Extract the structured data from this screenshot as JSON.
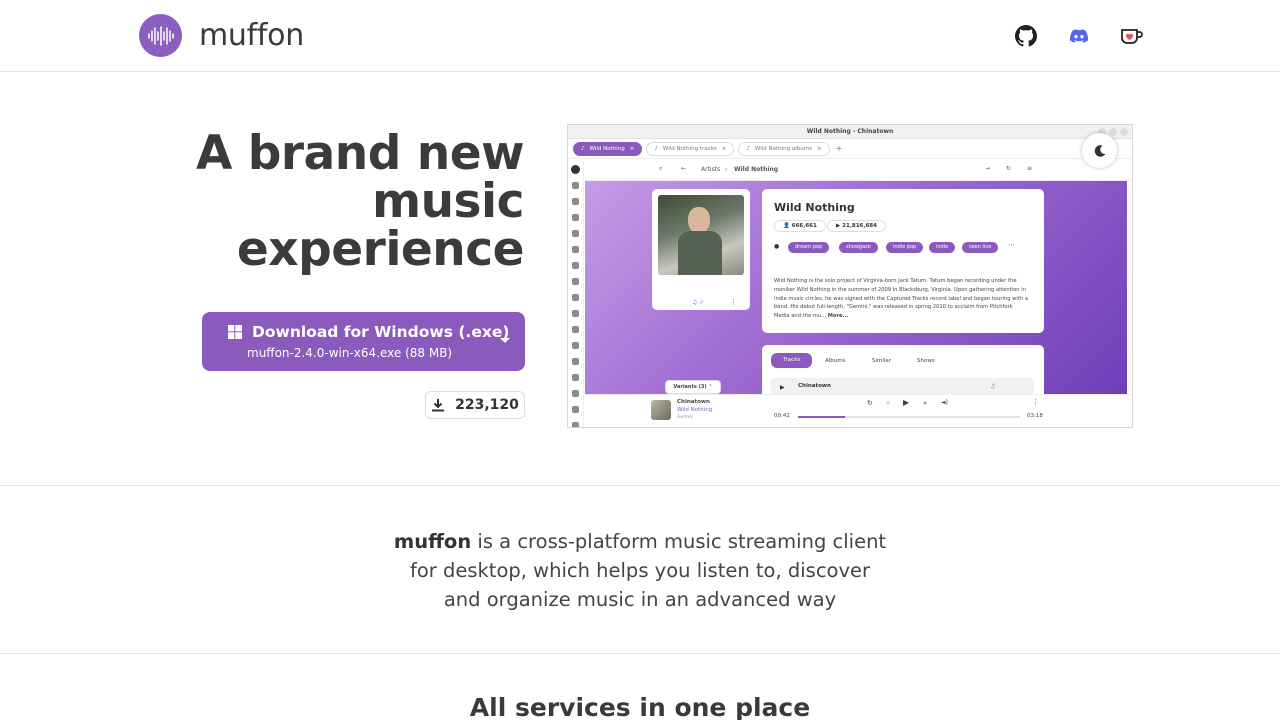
{
  "header": {
    "brand": "muffon",
    "icons": [
      "github-icon",
      "discord-icon",
      "kofi-icon"
    ]
  },
  "hero": {
    "title_lines": [
      "A brand new",
      "music",
      "experience"
    ],
    "download": {
      "label": "Download for Windows (.exe)",
      "file": "muffon-2.4.0-win-x64.exe (88 MB)"
    },
    "download_count": "223,120"
  },
  "screenshot": {
    "window_title": "Wild Nothing - Chinatown",
    "tabs": [
      "Wild Nothing",
      "Wild Nothing tracks",
      "Wild Nothing albums"
    ],
    "breadcrumb": [
      "Artists",
      "Wild Nothing"
    ],
    "artist": {
      "name": "Wild Nothing",
      "listeners": "666,661",
      "plays": "21,816,684",
      "tags": [
        "dream pop",
        "showgaze",
        "indie pop",
        "indie",
        "seen live"
      ],
      "bio": "Wild Nothing is the solo project of Virginia-born Jack Tatum. Tatum began recording under the moniker Wild Nothing in the summer of 2009 in Blacksburg, Virginia. Upon gathering attention in indie music circles, he was signed with the Captured Tracks record label and began touring with a band. His debut full-length, \"Gemini,\" was released in spring 2010 to acclaim from Pitchfork Media and the mu...",
      "more": "More..."
    },
    "sub_tabs": [
      "Tracks",
      "Albums",
      "Similar",
      "Shows"
    ],
    "track_row": "Chinatown",
    "variants": "Variants (3)",
    "player": {
      "track": "Chinatown",
      "artist": "Wild Nothing",
      "album": "Gemini",
      "elapsed": "00:42",
      "duration": "03:18",
      "progress": 0.21
    }
  },
  "description": {
    "brand": "muffon",
    "text_line1": " is a cross-platform music streaming client",
    "text_line2": "for desktop, which helps you listen to, discover",
    "text_line3": "and organize music in an advanced way"
  },
  "services": {
    "title": "All services in one place"
  },
  "colors": {
    "accent": "#8a5bbd",
    "logo": "#8b5fc0",
    "discord": "#5865f2"
  }
}
